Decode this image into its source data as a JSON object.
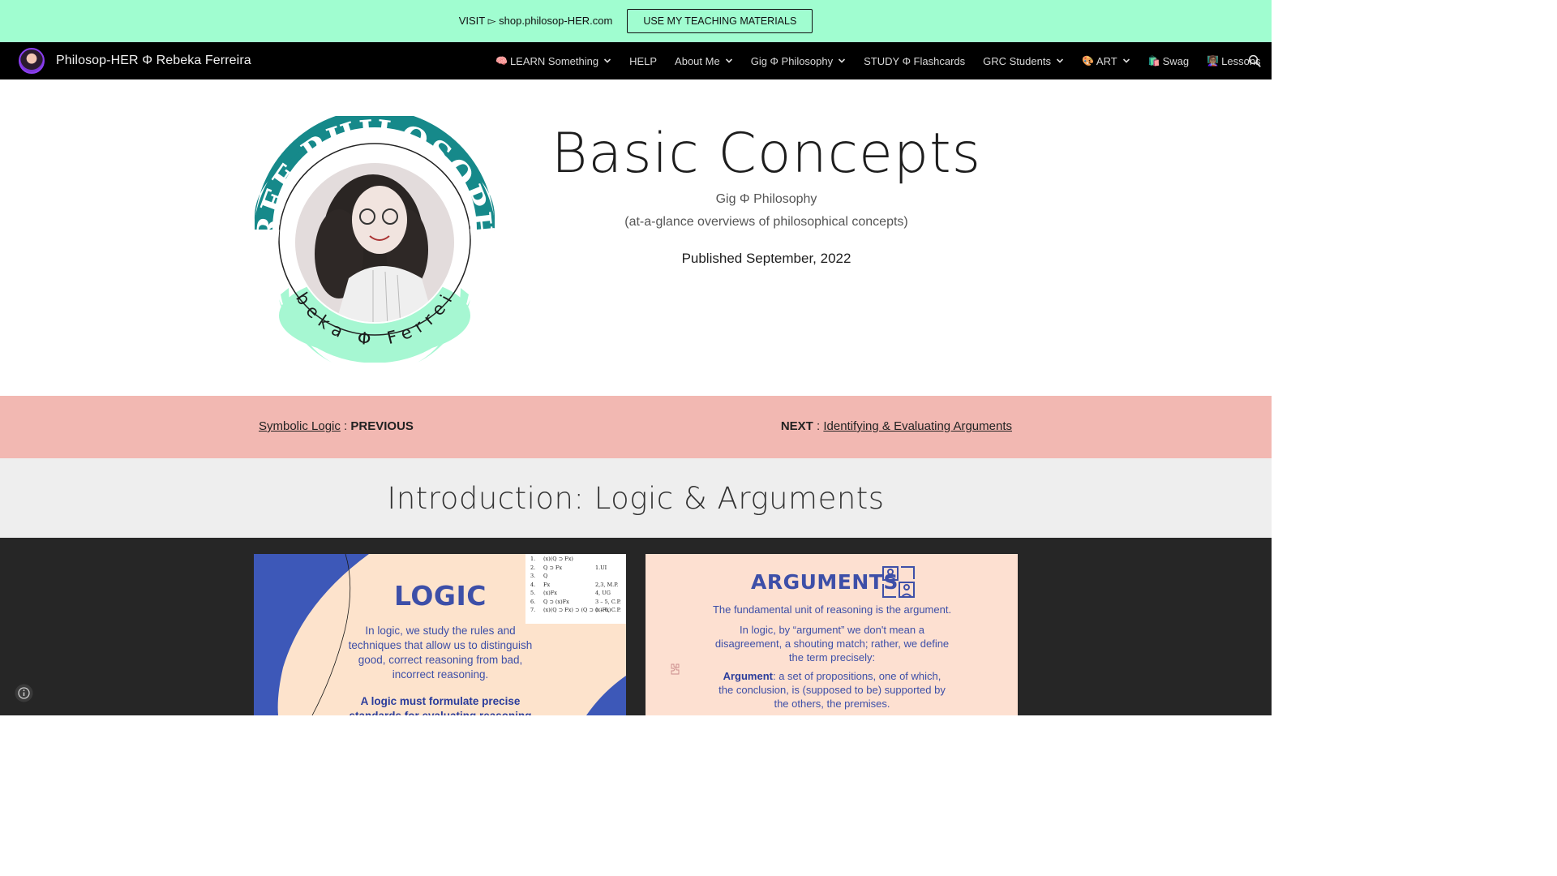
{
  "announcement": {
    "text": "VISIT ▻ shop.philosop-HER.com",
    "button_label": "USE MY TEACHING MATERIALS"
  },
  "navbar": {
    "site_title": "Philosop-HER Φ Rebeka Ferreira",
    "items": [
      {
        "emoji": "🧠",
        "label": "LEARN Something",
        "dropdown": true
      },
      {
        "emoji": "",
        "label": "HELP",
        "dropdown": false
      },
      {
        "emoji": "",
        "label": "About Me",
        "dropdown": true
      },
      {
        "emoji": "",
        "label": "Gig Φ Philosophy",
        "dropdown": true
      },
      {
        "emoji": "",
        "label": "STUDY Φ Flashcards",
        "dropdown": false
      },
      {
        "emoji": "",
        "label": "GRC Students",
        "dropdown": true
      },
      {
        "emoji": "🎨",
        "label": "ART",
        "dropdown": true
      },
      {
        "emoji": "🛍️",
        "label": "Swag",
        "dropdown": false
      },
      {
        "emoji": "👩🏽‍🏫",
        "label": "Lessons",
        "dropdown": false
      }
    ],
    "search_icon": "search-icon"
  },
  "hero": {
    "emblem_top_text": "FREE PHILOSOPHY",
    "emblem_bottom_text": "Rebeka Φ Ferreira",
    "title": "Basic Concepts",
    "subtitle_1": "Gig Φ Philosophy",
    "subtitle_2": "(at-a-glance overviews of philosophical concepts)",
    "published": "Published September, 2022"
  },
  "pager": {
    "prev_link": "Symbolic Logic",
    "prev_sep": " : ",
    "prev_label": "PREVIOUS",
    "next_label": "NEXT",
    "next_sep": " : ",
    "next_link": "Identifying & Evaluating Arguments"
  },
  "section": {
    "title": "Introduction: Logic & Arguments"
  },
  "cards": {
    "logic": {
      "title": "LOGIC",
      "body": "In logic, we study the rules and techniques that allow us to distinguish good, correct reasoning from bad, incorrect reasoning.",
      "bold": "A logic must formulate precise standards for evaluating reasoning",
      "proof": [
        {
          "n": "1.",
          "f": "(x)(Q ⊃ Fx)",
          "r": ""
        },
        {
          "n": "2.",
          "f": "Q ⊃ Fx",
          "r": "1.UI"
        },
        {
          "n": "3.",
          "f": "Q",
          "r": ""
        },
        {
          "n": "4.",
          "f": "Fx",
          "r": "2,3, M.P."
        },
        {
          "n": "5.",
          "f": "(x)Fx",
          "r": "4, UG"
        },
        {
          "n": "6.",
          "f": "Q ⊃ (x)Fx",
          "r": "3 – 5, C.P."
        },
        {
          "n": "7.",
          "f": "(x)(Q ⊃ Fx) ⊃ (Q ⊃ (x)Fx)",
          "r": "1 – 6, C.P."
        }
      ]
    },
    "arguments": {
      "title": "ARGUMENTS",
      "p1": "The fundamental unit of reasoning is the argument.",
      "p2": "In logic, by “argument” we don't mean a disagreement, a shouting match; rather, we define the term precisely:",
      "p3_bold": "Argument",
      "p3_rest": ": a set of propositions, one of which, the conclusion, is (supposed to be) supported by the others, the premises."
    }
  },
  "colors": {
    "announcement_bg": "#a0fdd0",
    "navbar_bg": "#000000",
    "pager_bg": "#f2b8b2",
    "section_bg": "#eeeeee",
    "gallery_bg": "#262626",
    "card_text": "#3d4fa8",
    "emblem_teal": "#16898a",
    "emblem_mint": "#a6f7d2"
  }
}
